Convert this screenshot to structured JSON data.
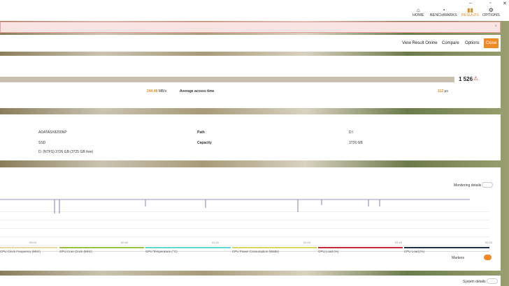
{
  "window": {
    "minimize": "–",
    "maximize": "▫",
    "close": "✕"
  },
  "nav": [
    {
      "label": "HOME",
      "icon": "home-icon"
    },
    {
      "label": "BENCHMARKS",
      "icon": "gauge-icon"
    },
    {
      "label": "RESULTS",
      "icon": "bar-chart-icon",
      "active": true
    },
    {
      "label": "OPTIONS",
      "icon": "gear-icon"
    }
  ],
  "banner": {
    "close": "×"
  },
  "actions": {
    "view_online": "View Result Online",
    "compare": "Compare",
    "options": "Options",
    "close": "Close"
  },
  "score": {
    "value": "1 526",
    "warning": "⚠",
    "bandwidth_value": "244.48",
    "bandwidth_unit": "MB/s",
    "access_label": "Average access time",
    "access_value": "112",
    "access_unit": "μs",
    "progress_fraction": 0.9
  },
  "details": {
    "model": "ADATASX8200NP",
    "type": "SSD",
    "drive": "D: (NTFS) 3726 GB (3725 GB free)",
    "path_label": "Path",
    "path_value": "D:\\",
    "capacity_label": "Capacity",
    "capacity_value": "3726 GB"
  },
  "monitoring": {
    "toggle_label": "Monitoring details",
    "markers_label": "Markers",
    "x_ticks": [
      "00:00",
      "00:40",
      "01:20",
      "02:00",
      "02:40",
      "03:20"
    ],
    "legend": [
      {
        "label": "CPU Clock Frequency (MHz)",
        "color": "#e7d9a6"
      },
      {
        "label": "GPU Core Clock (MHz)",
        "color": "#9bc140"
      },
      {
        "label": "GPU Temperature (°C)",
        "color": "#5ed8d0"
      },
      {
        "label": "CPU Power Consumption (Watts)",
        "color": "#d8d860"
      },
      {
        "label": "GPU Load (%)",
        "color": "#c8283c"
      },
      {
        "label": "CPU Load (%)",
        "color": "#1e2f52"
      }
    ]
  },
  "system": {
    "toggle_label": "System details"
  }
}
